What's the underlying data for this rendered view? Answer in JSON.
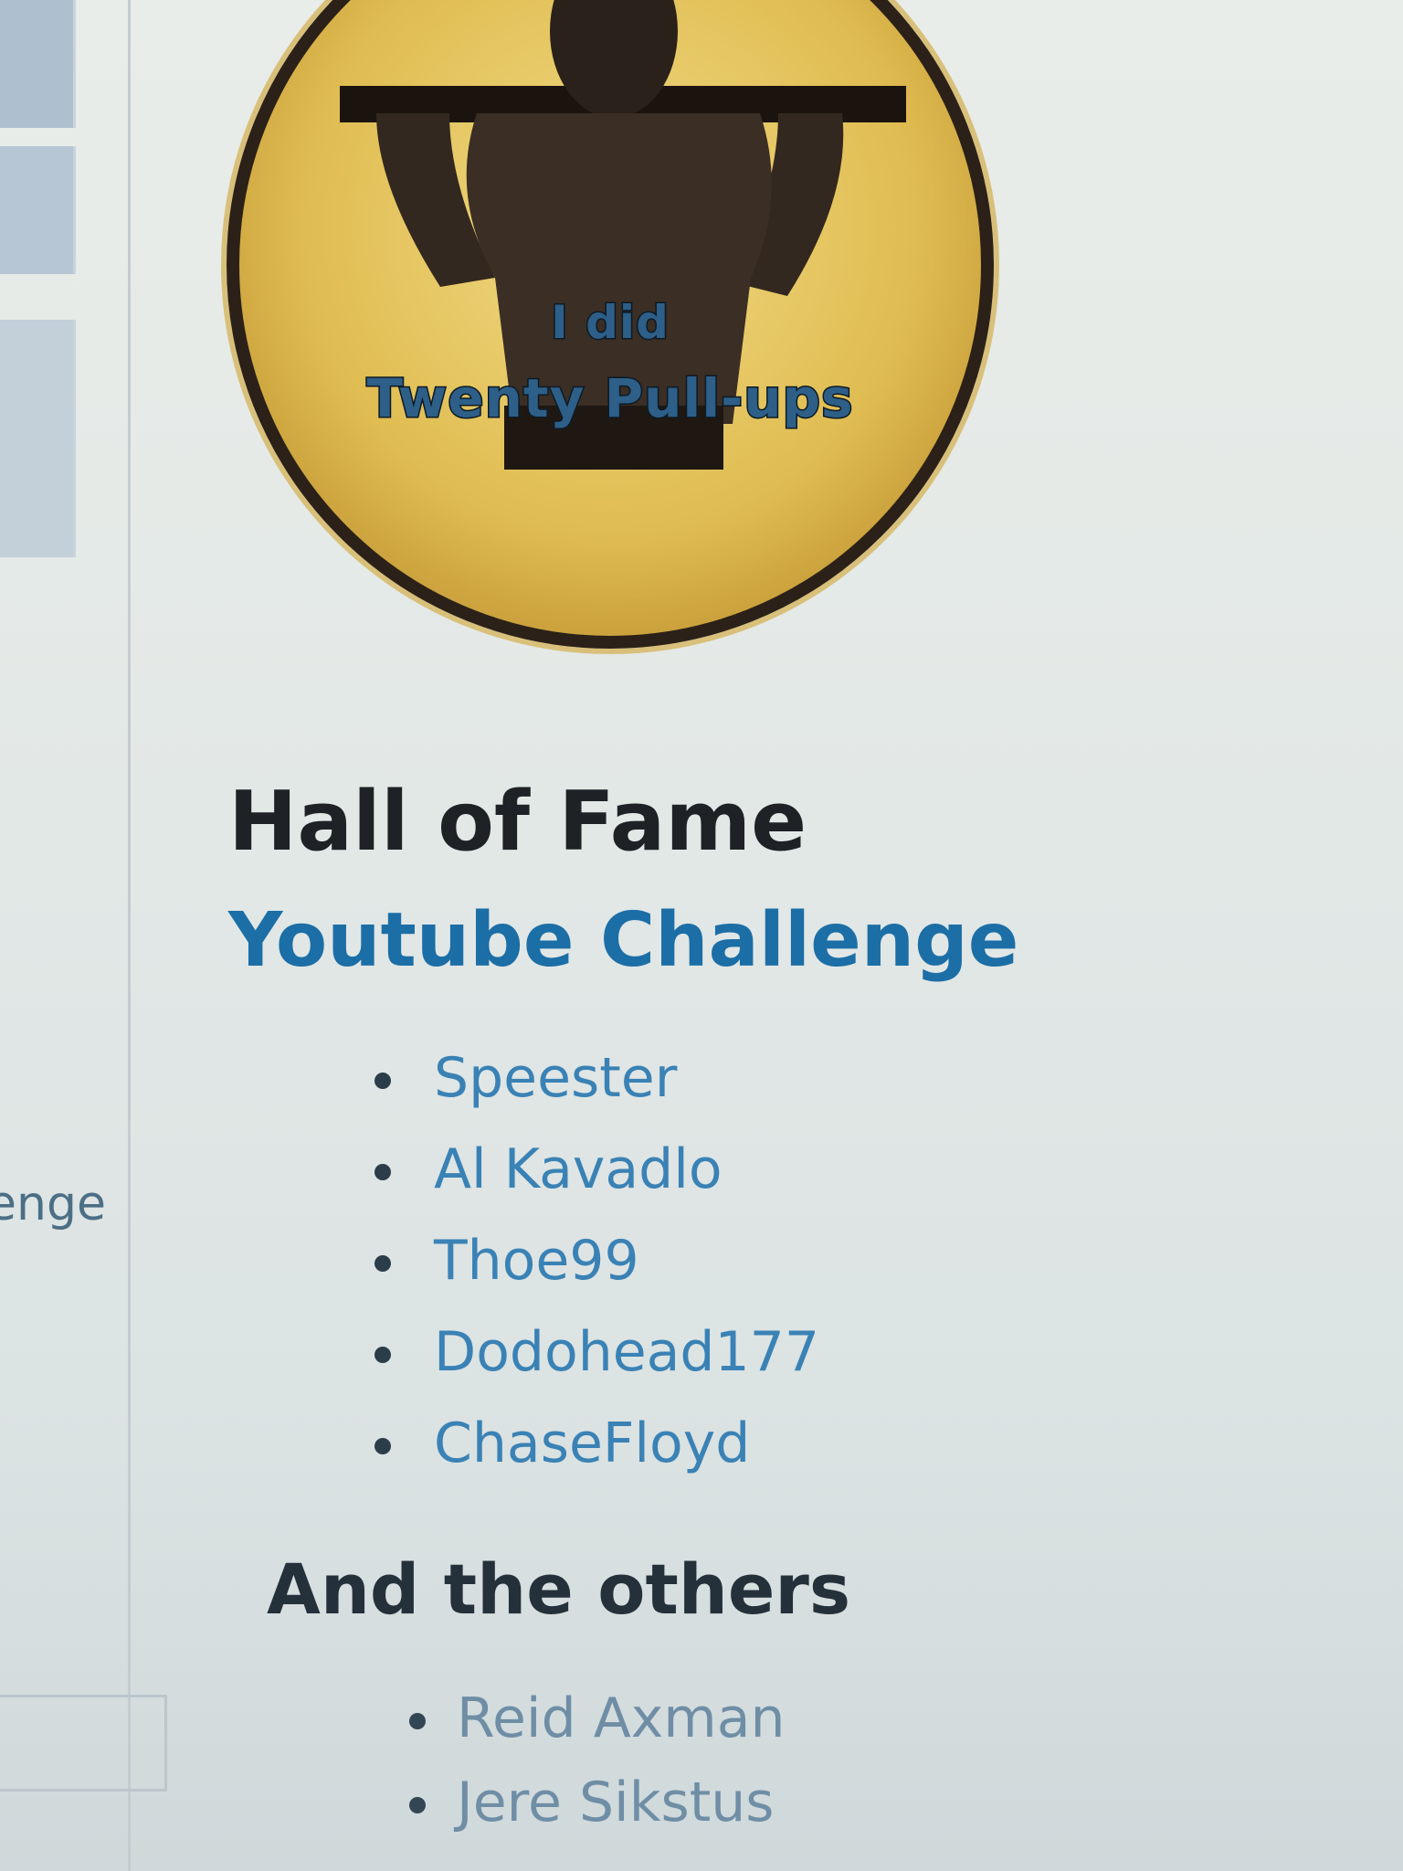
{
  "sidebar": {
    "fragment_text": "enge"
  },
  "badge": {
    "line1": "I did",
    "line2": "Twenty Pull-ups",
    "icon": "pull-up-figure-icon"
  },
  "hall_of_fame": {
    "title": "Hall of Fame",
    "youtube_heading": "Youtube Challenge",
    "youtube_list": [
      "Speester",
      "Al Kavadlo",
      "Thoe99",
      "Dodohead177",
      "ChaseFloyd"
    ],
    "others_heading": "And the others",
    "others_list": [
      "Reid Axman",
      "Jere Sikstus"
    ]
  },
  "colors": {
    "link_blue": "#3a82b5",
    "heading_blue": "#1c6ea6",
    "badge_gold": "#e0bd52"
  }
}
